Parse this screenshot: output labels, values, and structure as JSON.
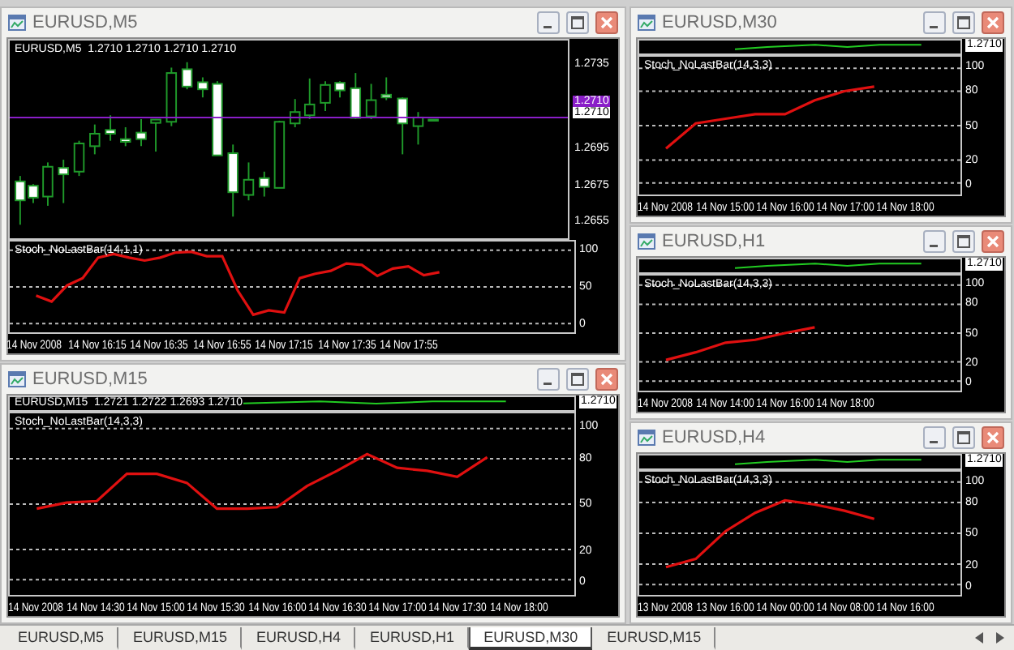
{
  "windows": [
    {
      "kind": "candles",
      "title": "EURUSD,M5",
      "header": "EURUSD,M5  1.2710 1.2710 1.2710 1.2710",
      "price_labels": [
        {
          "text": "1.2735",
          "kind": "plain"
        },
        {
          "text": "1.2710",
          "kind": "bid"
        },
        {
          "text": "1.2710",
          "kind": "current"
        },
        {
          "text": "1.2695",
          "kind": "plain"
        },
        {
          "text": "1.2675",
          "kind": "plain"
        },
        {
          "text": "1.2655",
          "kind": "plain"
        }
      ],
      "chart_data": {
        "type": "line",
        "grid": true,
        "ylim": [
          -12,
          112
        ],
        "yticks": [
          0,
          50,
          100
        ],
        "categories": [
          "14 Nov 2008",
          null,
          null,
          null,
          "14 Nov 16:15",
          null,
          null,
          null,
          "14 Nov 16:35",
          null,
          null,
          null,
          "14 Nov 16:55",
          null,
          null,
          null,
          "14 Nov 17:15",
          null,
          null,
          null,
          "14 Nov 17:35",
          null,
          null,
          null,
          "14 Nov 17:55",
          null,
          null,
          null,
          null,
          null,
          null,
          null,
          null,
          null
        ],
        "series": [
          {
            "name": "Stoch_NoLastBar(14,1,1)",
            "color": "#e01010",
            "values": [
              38,
              30,
              52,
              62,
              90,
              95,
              90,
              86,
              90,
              97,
              98,
              92,
              92,
              45,
              12,
              18,
              15,
              62,
              68,
              72,
              82,
              80,
              65,
              75,
              78,
              66,
              70,
              null,
              null,
              null,
              null,
              null,
              null,
              null
            ]
          }
        ]
      }
    },
    {
      "kind": "lines",
      "title": "EURUSD,M30",
      "price": "1.2710",
      "chart_data": {
        "type": "line",
        "grid": true,
        "ylim": [
          -10,
          110
        ],
        "yticks": [
          0,
          20,
          50,
          80,
          100
        ],
        "categories": [
          "14 Nov 2008",
          null,
          "14 Nov 15:00",
          null,
          "14 Nov 16:00",
          null,
          "14 Nov 17:00",
          null,
          "14 Nov 18:00",
          null
        ],
        "series": [
          {
            "name": "Stoch_NoLastBar(14,3,3)",
            "color": "#e01010",
            "values": [
              30,
              52,
              56,
              60,
              60,
              72,
              80,
              84,
              null,
              null
            ]
          }
        ]
      }
    },
    {
      "kind": "lines",
      "title": "EURUSD,H1",
      "price": "1.2710",
      "chart_data": {
        "type": "line",
        "grid": true,
        "ylim": [
          -10,
          110
        ],
        "yticks": [
          0,
          20,
          50,
          80,
          100
        ],
        "categories": [
          "14 Nov 2008",
          null,
          "14 Nov 14:00",
          null,
          "14 Nov 16:00",
          null,
          "14 Nov 18:00",
          null,
          null,
          null
        ],
        "series": [
          {
            "name": "Stoch_NoLastBar(14,3,3)",
            "color": "#e01010",
            "values": [
              22,
              30,
              40,
              43,
              50,
              56,
              null,
              null,
              null,
              null
            ]
          }
        ]
      }
    },
    {
      "kind": "lines",
      "title": "EURUSD,M15",
      "header": "EURUSD,M15  1.2721 1.2722 1.2693 1.2710",
      "price": "1.2710",
      "chart_data": {
        "type": "line",
        "grid": true,
        "ylim": [
          -10,
          110
        ],
        "yticks": [
          0,
          20,
          50,
          80,
          100
        ],
        "categories": [
          "14 Nov 2008",
          null,
          "14 Nov 14:30",
          null,
          "14 Nov 15:00",
          null,
          "14 Nov 15:30",
          null,
          "14 Nov 16:00",
          null,
          "14 Nov 16:30",
          null,
          "14 Nov 17:00",
          null,
          "14 Nov 17:30",
          null,
          "14 Nov 18:00",
          null
        ],
        "series": [
          {
            "name": "Stoch_NoLastBar(14,3,3)",
            "color": "#e01010",
            "values": [
              47,
              51,
              52,
              70,
              70,
              64,
              47,
              47,
              48,
              62,
              72,
              83,
              74,
              72,
              68,
              81,
              null,
              null
            ]
          }
        ]
      }
    },
    {
      "kind": "lines",
      "title": "EURUSD,H4",
      "price": "1.2710",
      "chart_data": {
        "type": "line",
        "grid": true,
        "ylim": [
          -10,
          110
        ],
        "yticks": [
          0,
          20,
          50,
          80,
          100
        ],
        "categories": [
          "13 Nov 2008",
          null,
          "13 Nov 16:00",
          null,
          "14 Nov 00:00",
          null,
          "14 Nov 08:00",
          null,
          "14 Nov 16:00",
          null
        ],
        "series": [
          {
            "name": "Stoch_NoLastBar(14,3,3)",
            "color": "#e01010",
            "values": [
              17,
              25,
              52,
              70,
              82,
              78,
              72,
              64,
              null,
              null
            ]
          }
        ]
      }
    }
  ],
  "tabs": [
    {
      "label": "EURUSD,M5",
      "selected": false
    },
    {
      "label": "EURUSD,M15",
      "selected": false
    },
    {
      "label": "EURUSD,H4",
      "selected": false
    },
    {
      "label": "EURUSD,H1",
      "selected": false
    },
    {
      "label": "EURUSD,M30",
      "selected": true
    },
    {
      "label": "EURUSD,M15",
      "selected": false
    }
  ]
}
